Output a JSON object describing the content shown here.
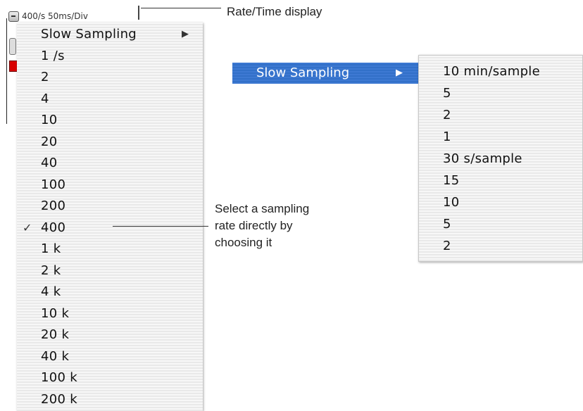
{
  "background_app": {
    "rate_display_text": "400/s  50ms/Div"
  },
  "main_menu": {
    "items": [
      {
        "label": "Slow Sampling",
        "has_submenu": true,
        "checked": false
      },
      {
        "label": "1 /s",
        "checked": false
      },
      {
        "label": "2",
        "checked": false
      },
      {
        "label": "4",
        "checked": false
      },
      {
        "label": "10",
        "checked": false
      },
      {
        "label": "20",
        "checked": false
      },
      {
        "label": "40",
        "checked": false
      },
      {
        "label": "100",
        "checked": false
      },
      {
        "label": "200",
        "checked": false
      },
      {
        "label": "400",
        "checked": true
      },
      {
        "label": "1 k",
        "checked": false
      },
      {
        "label": "2 k",
        "checked": false
      },
      {
        "label": "4 k",
        "checked": false
      },
      {
        "label": "10 k",
        "checked": false
      },
      {
        "label": "20 k",
        "checked": false
      },
      {
        "label": "40 k",
        "checked": false
      },
      {
        "label": "100 k",
        "checked": false
      },
      {
        "label": "200 k",
        "checked": false
      }
    ],
    "check_glyph": "✓",
    "submenu_arrow": "▶"
  },
  "slow_sampling_menu": {
    "parent_label": "Slow Sampling",
    "arrow": "▶",
    "items": [
      "10 min/sample",
      "5",
      "2",
      "1",
      "30 s/sample",
      "15",
      "10",
      "5",
      "2"
    ]
  },
  "callouts": {
    "rate_time": "Rate/Time display",
    "select_line1": "Select a sampling",
    "select_line2": "rate directly by",
    "select_line3": "choosing it"
  },
  "colors": {
    "highlight": "#3a76cf",
    "menu_bg": "#f6f6f6"
  }
}
